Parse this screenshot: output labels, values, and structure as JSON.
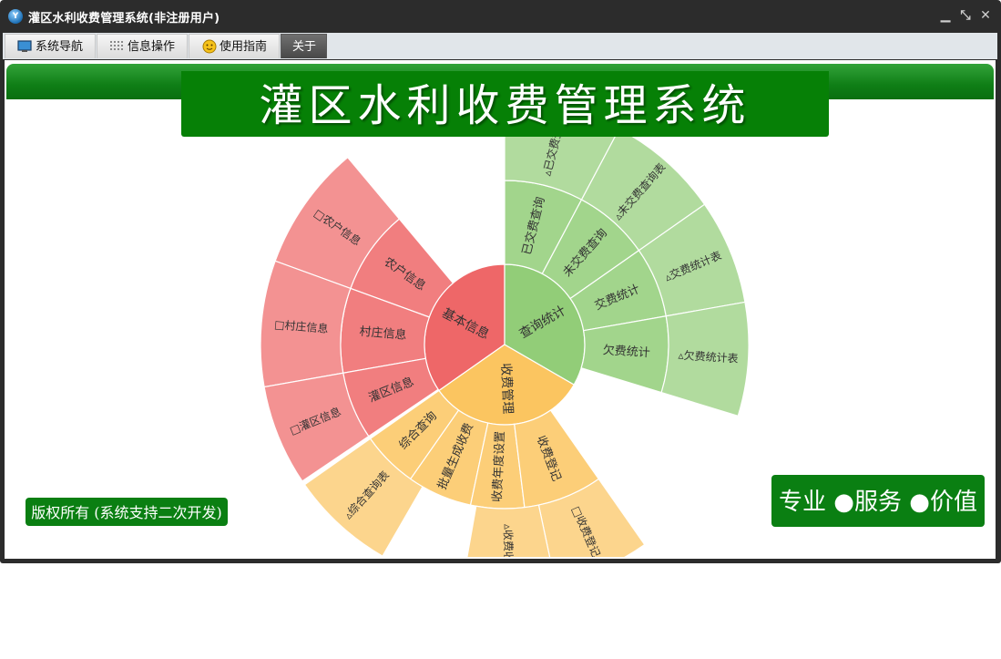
{
  "window": {
    "title": "灌区水利收费管理系统(非注册用户)",
    "app_icon": "yf-app-icon",
    "controls": {
      "minimize": "▁",
      "restore": "⤡",
      "close": "✕"
    }
  },
  "menu": [
    {
      "label": "系统导航",
      "icon": "monitor-icon",
      "active": false
    },
    {
      "label": "信息操作",
      "icon": "grid-icon",
      "active": false
    },
    {
      "label": "使用指南",
      "icon": "smiley-icon",
      "active": false
    },
    {
      "label": "关于",
      "icon": "",
      "active": true
    }
  ],
  "banner": {
    "title": "灌区水利收费管理系统"
  },
  "copyright": "版权所有 (系统支持二次开发)",
  "slogan": "专业 ●服务 ●价值",
  "colors": {
    "green_bar": "#0a7f12",
    "basic_info": "#ee6768",
    "fee_mgmt": "#fbc560",
    "query_stats": "#92cd78"
  },
  "sunburst": {
    "center": [
      {
        "name": "基本信息",
        "group": "basic",
        "color": "#ee6768",
        "children": [
          {
            "name": "农户信息",
            "leaf": "□农户信息"
          },
          {
            "name": "村庄信息",
            "leaf": "□村庄信息"
          },
          {
            "name": "灌区信息",
            "leaf": "□灌区信息"
          }
        ]
      },
      {
        "name": "收费管理",
        "group": "fee",
        "color": "#fbc560",
        "children": [
          {
            "name": "综合查询",
            "leaf": "▵综合查询表"
          },
          {
            "name": "批量生成收费",
            "leaf": ""
          },
          {
            "name": "收费年度设置",
            "leaf": ""
          },
          {
            "name": "收费登记",
            "leaf": "□收费登记"
          },
          {
            "name": "",
            "leaf": "▵收费收据"
          }
        ]
      },
      {
        "name": "查询统计",
        "group": "query",
        "color": "#92cd78",
        "children": [
          {
            "name": "已交费查询",
            "leaf": "▵已交费查询"
          },
          {
            "name": "未交费查询",
            "leaf": "▵未交费查询表"
          },
          {
            "name": "交费统计",
            "leaf": "▵交费统计表"
          },
          {
            "name": "欠费统计",
            "leaf": "▵欠费统计表"
          }
        ]
      }
    ]
  }
}
